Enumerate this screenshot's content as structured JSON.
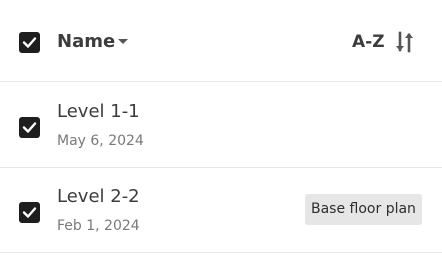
{
  "header": {
    "select_all_checked": true,
    "name_label": "Name",
    "sort_label": "A-Z",
    "sort_icon": "sort-arrows-icon",
    "caret_icon": "caret-down-icon"
  },
  "rows": [
    {
      "checked": true,
      "title": "Level 1-1",
      "date": "May 6, 2024",
      "tag": ""
    },
    {
      "checked": true,
      "title": "Level 2-2",
      "date": "Feb 1, 2024",
      "tag": "Base floor plan"
    }
  ],
  "colors": {
    "checkbox": "#1e1e1e",
    "divider": "#e6e6e6",
    "tag_bg": "#e6e6e6",
    "text": "#3c3c3c",
    "muted_text": "#7a7a7a"
  }
}
